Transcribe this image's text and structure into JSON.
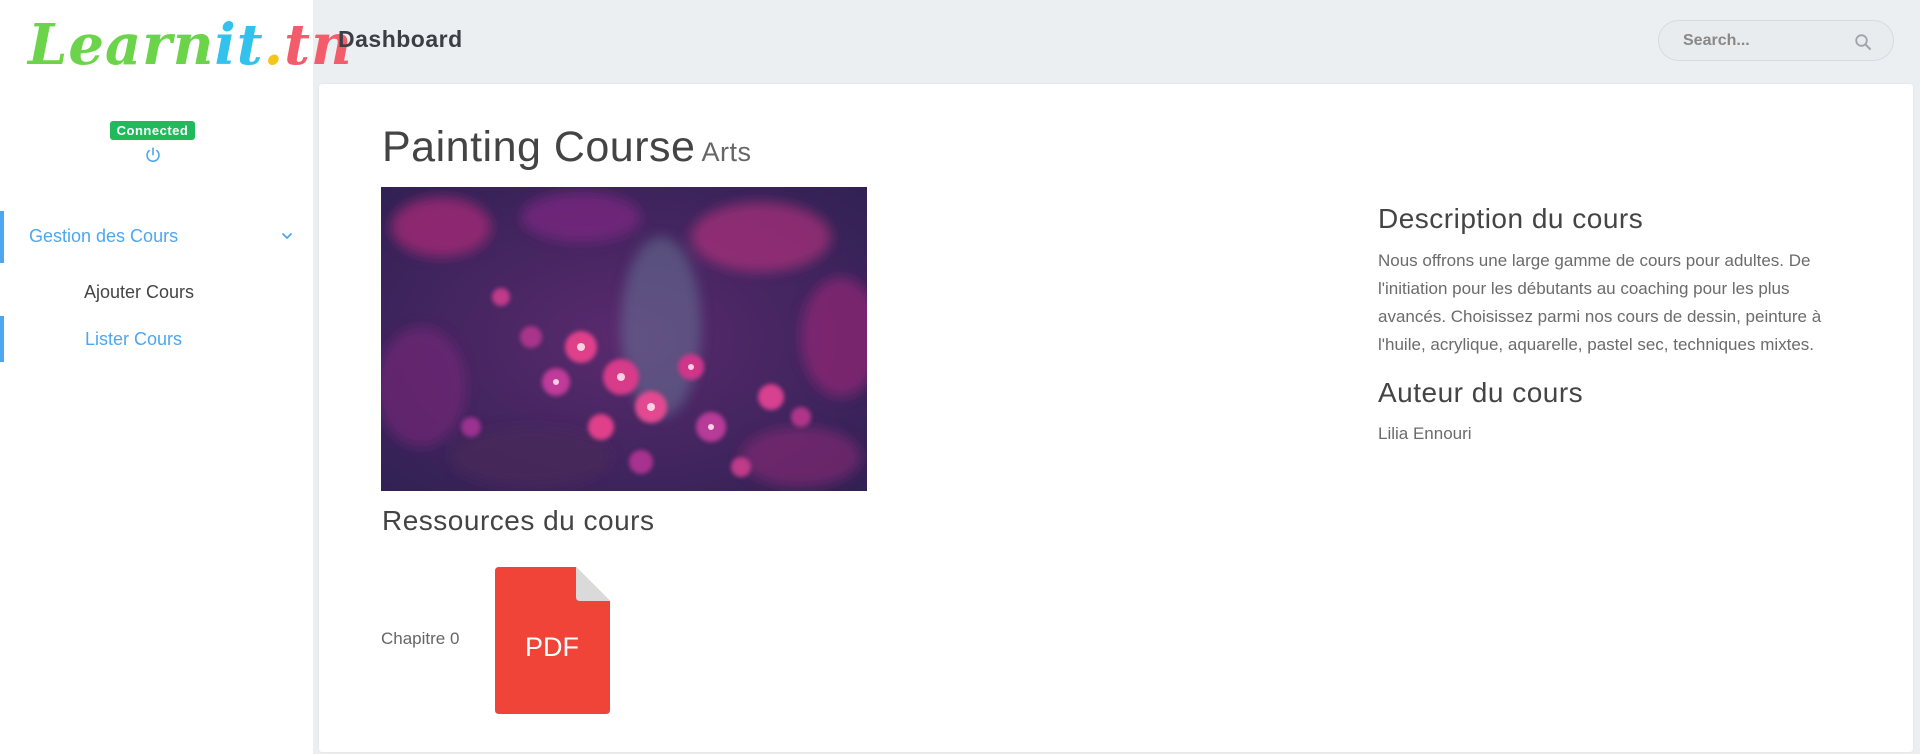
{
  "logo": {
    "part1": "Learn",
    "part2": "it",
    "part3": ".",
    "part4": "tn"
  },
  "sidebar": {
    "status_badge": "Connected",
    "menu_group": {
      "label": "Gestion des Cours",
      "icon": "chevron-down-icon"
    },
    "items": [
      {
        "label": "Ajouter Cours",
        "active": false
      },
      {
        "label": "Lister Cours",
        "active": true
      }
    ]
  },
  "header": {
    "title": "Dashboard",
    "search_placeholder": "Search...",
    "search_icon": "search-icon"
  },
  "course": {
    "title": "Painting Course",
    "category": "Arts",
    "description_heading": "Description du cours",
    "description": "Nous offrons une large gamme de cours pour adultes. De l'initiation pour les débutants au coaching pour les plus avancés. Choisissez parmi nos cours de dessin, peinture à l'huile, acrylique, aquarelle, pastel sec, techniques mixtes.",
    "author_heading": "Auteur du cours",
    "author": "Lilia Ennouri",
    "resources_heading": "Ressources du cours",
    "resources": [
      {
        "label": "Chapitre 0",
        "file_type": "PDF"
      }
    ]
  },
  "colors": {
    "accent": "#4da7f0",
    "status_green": "#1fba5c",
    "pdf_red": "#f04438"
  }
}
